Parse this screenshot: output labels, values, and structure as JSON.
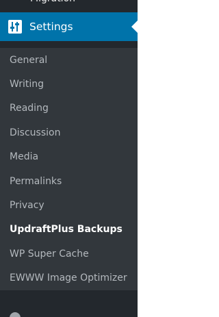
{
  "sidebar": {
    "previous_item": "Migration",
    "settings_label": "Settings",
    "submenu": [
      {
        "label": "General",
        "current": false
      },
      {
        "label": "Writing",
        "current": false
      },
      {
        "label": "Reading",
        "current": false
      },
      {
        "label": "Discussion",
        "current": false
      },
      {
        "label": "Media",
        "current": false
      },
      {
        "label": "Permalinks",
        "current": false
      },
      {
        "label": "Privacy",
        "current": false
      },
      {
        "label": "UpdraftPlus Backups",
        "current": true
      },
      {
        "label": "WP Super Cache",
        "current": false
      },
      {
        "label": "EWWW Image Optimizer",
        "current": false
      }
    ],
    "icons": {
      "settings": "settings-sliders-icon",
      "next_item": "menu-circle-icon"
    },
    "colors": {
      "sidebar_bg": "#23282d",
      "submenu_bg": "#32373c",
      "active_bg": "#0073aa",
      "submenu_text": "#b4b9be",
      "current_text": "#ffffff"
    }
  }
}
